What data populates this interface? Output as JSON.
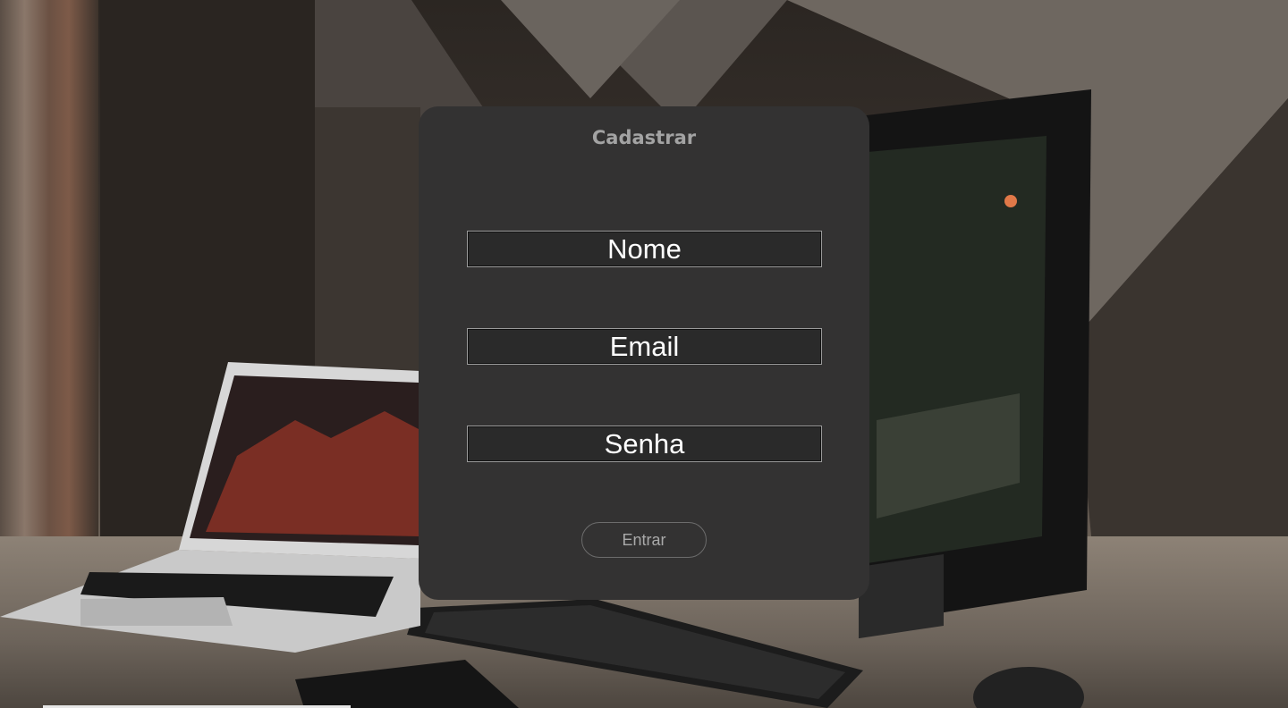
{
  "form": {
    "title": "Cadastrar",
    "fields": {
      "nome": {
        "placeholder": "Nome",
        "value": ""
      },
      "email": {
        "placeholder": "Email",
        "value": ""
      },
      "senha": {
        "placeholder": "Senha",
        "value": ""
      }
    },
    "submit_label": "Entrar"
  },
  "colors": {
    "card": "#333232",
    "title": "#a3a3a3",
    "field_text": "#ffffff",
    "button_text": "#a9a9a9"
  }
}
